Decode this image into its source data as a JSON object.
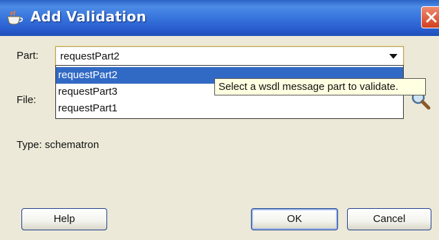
{
  "window": {
    "title": "Add Validation",
    "title_bar_color": "#2a5fcf",
    "close_button_color": "#d0401f"
  },
  "part": {
    "label": "Part:",
    "selected_value": "requestPart2",
    "options": [
      "requestPart2",
      "requestPart3",
      "requestPart1"
    ],
    "selected_option_color": "#316ac5"
  },
  "file": {
    "label": "File:"
  },
  "tooltip": {
    "text": "Select a wsdl message part to validate."
  },
  "type_info": "Type: schematron",
  "buttons": {
    "help": "Help",
    "ok": "OK",
    "cancel": "Cancel"
  },
  "icons": [
    "app-cup-icon",
    "close-icon",
    "chevron-down-icon",
    "search-icon"
  ]
}
